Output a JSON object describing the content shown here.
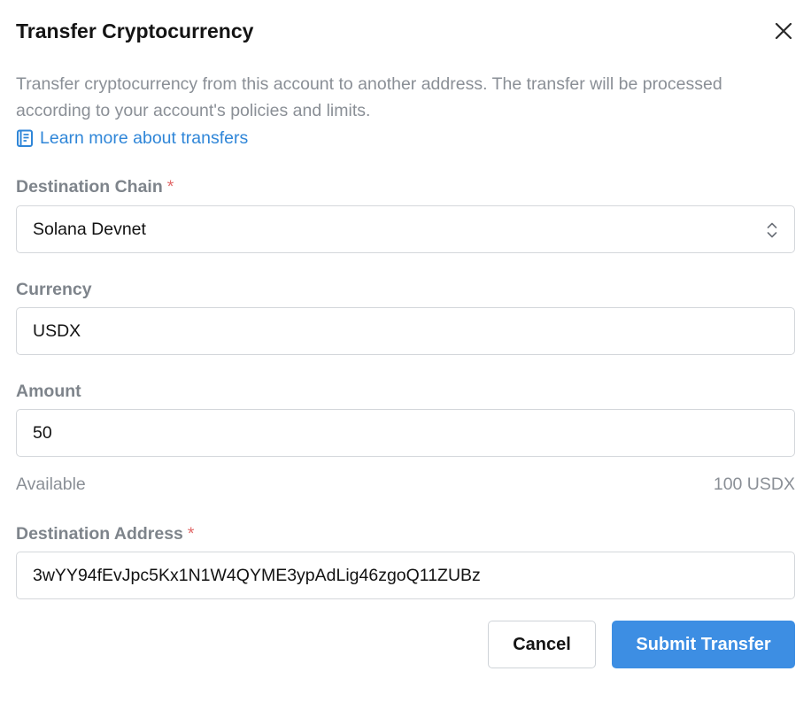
{
  "dialog": {
    "title": "Transfer Cryptocurrency",
    "close_icon": "close-icon",
    "description": "Transfer cryptocurrency from this account to another address. The transfer will be processed according to your account's policies and limits.",
    "learn_more": {
      "icon": "book-icon",
      "label": "Learn more about transfers"
    }
  },
  "form": {
    "destination_chain": {
      "label": "Destination Chain",
      "required_mark": "*",
      "value": "Solana Devnet",
      "icon": "chevron-up-down-icon"
    },
    "currency": {
      "label": "Currency",
      "value": "USDX"
    },
    "amount": {
      "label": "Amount",
      "value": "50"
    },
    "available": {
      "label": "Available",
      "value": "100 USDX"
    },
    "destination_address": {
      "label": "Destination Address",
      "required_mark": "*",
      "value": "3wYY94fEvJpc5Kx1N1W4QYME3ypAdLig46zgoQ11ZUBz"
    }
  },
  "actions": {
    "cancel_label": "Cancel",
    "submit_label": "Submit Transfer"
  },
  "colors": {
    "accent": "#3d8ee3",
    "link": "#2f86d8",
    "required": "#e26b6b",
    "muted_text": "#8a8f96"
  }
}
